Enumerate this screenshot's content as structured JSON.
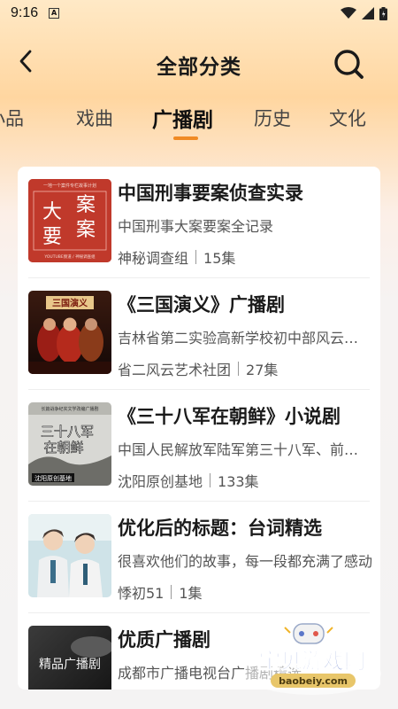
{
  "status": {
    "time": "9:16"
  },
  "header": {
    "title": "全部分类"
  },
  "tabs": [
    {
      "label": "小品",
      "active": false
    },
    {
      "label": "戏曲",
      "active": false
    },
    {
      "label": "广播剧",
      "active": true
    },
    {
      "label": "历史",
      "active": false
    },
    {
      "label": "文化",
      "active": false
    }
  ],
  "items": [
    {
      "title": "中国刑事要案侦查实录",
      "desc": "中国刑事大案要案全记录",
      "author": "神秘调查组",
      "count": "15集",
      "cover": {
        "top_text": "一地一个案件专栏故事计划",
        "chars": [
          "大",
          "案",
          "要",
          "案"
        ],
        "bottom_text": "YOUTUBE频道 / 神秘调查组"
      }
    },
    {
      "title": "《三国演义》广播剧",
      "desc": "吉林省第二实验高新学校初中部风云艺术社团",
      "author": "省二风云艺术社团",
      "count": "27集",
      "cover": {
        "banner": "三国演义"
      }
    },
    {
      "title": "《三十八军在朝鲜》小说剧",
      "desc": "中国人民解放军陆军第三十八军、前身为东北野战军",
      "author": "沈阳原创基地",
      "count": "133集",
      "cover": {
        "top_text": "长篇战争纪实文学改编广播剧",
        "line1": "三十八军",
        "line2": "在朝鲜",
        "bottom_text": "沈阳原创基地"
      }
    },
    {
      "title": "优化后的标题：台词精选",
      "desc": "很喜欢他们的故事，每一段都充满了感动",
      "author": "悸初51",
      "count": "1集",
      "cover": {}
    },
    {
      "title": "优质广播剧",
      "desc": "成都市广播电视台广播剧精选",
      "author": "",
      "count": "",
      "cover": {
        "label": "精品广播剧"
      }
    }
  ],
  "watermark": {
    "text": "宝贝游戏网",
    "url": "baobeiy.com"
  },
  "colors": {
    "accent": "#f08a24",
    "cover_red": "#c0392b"
  }
}
